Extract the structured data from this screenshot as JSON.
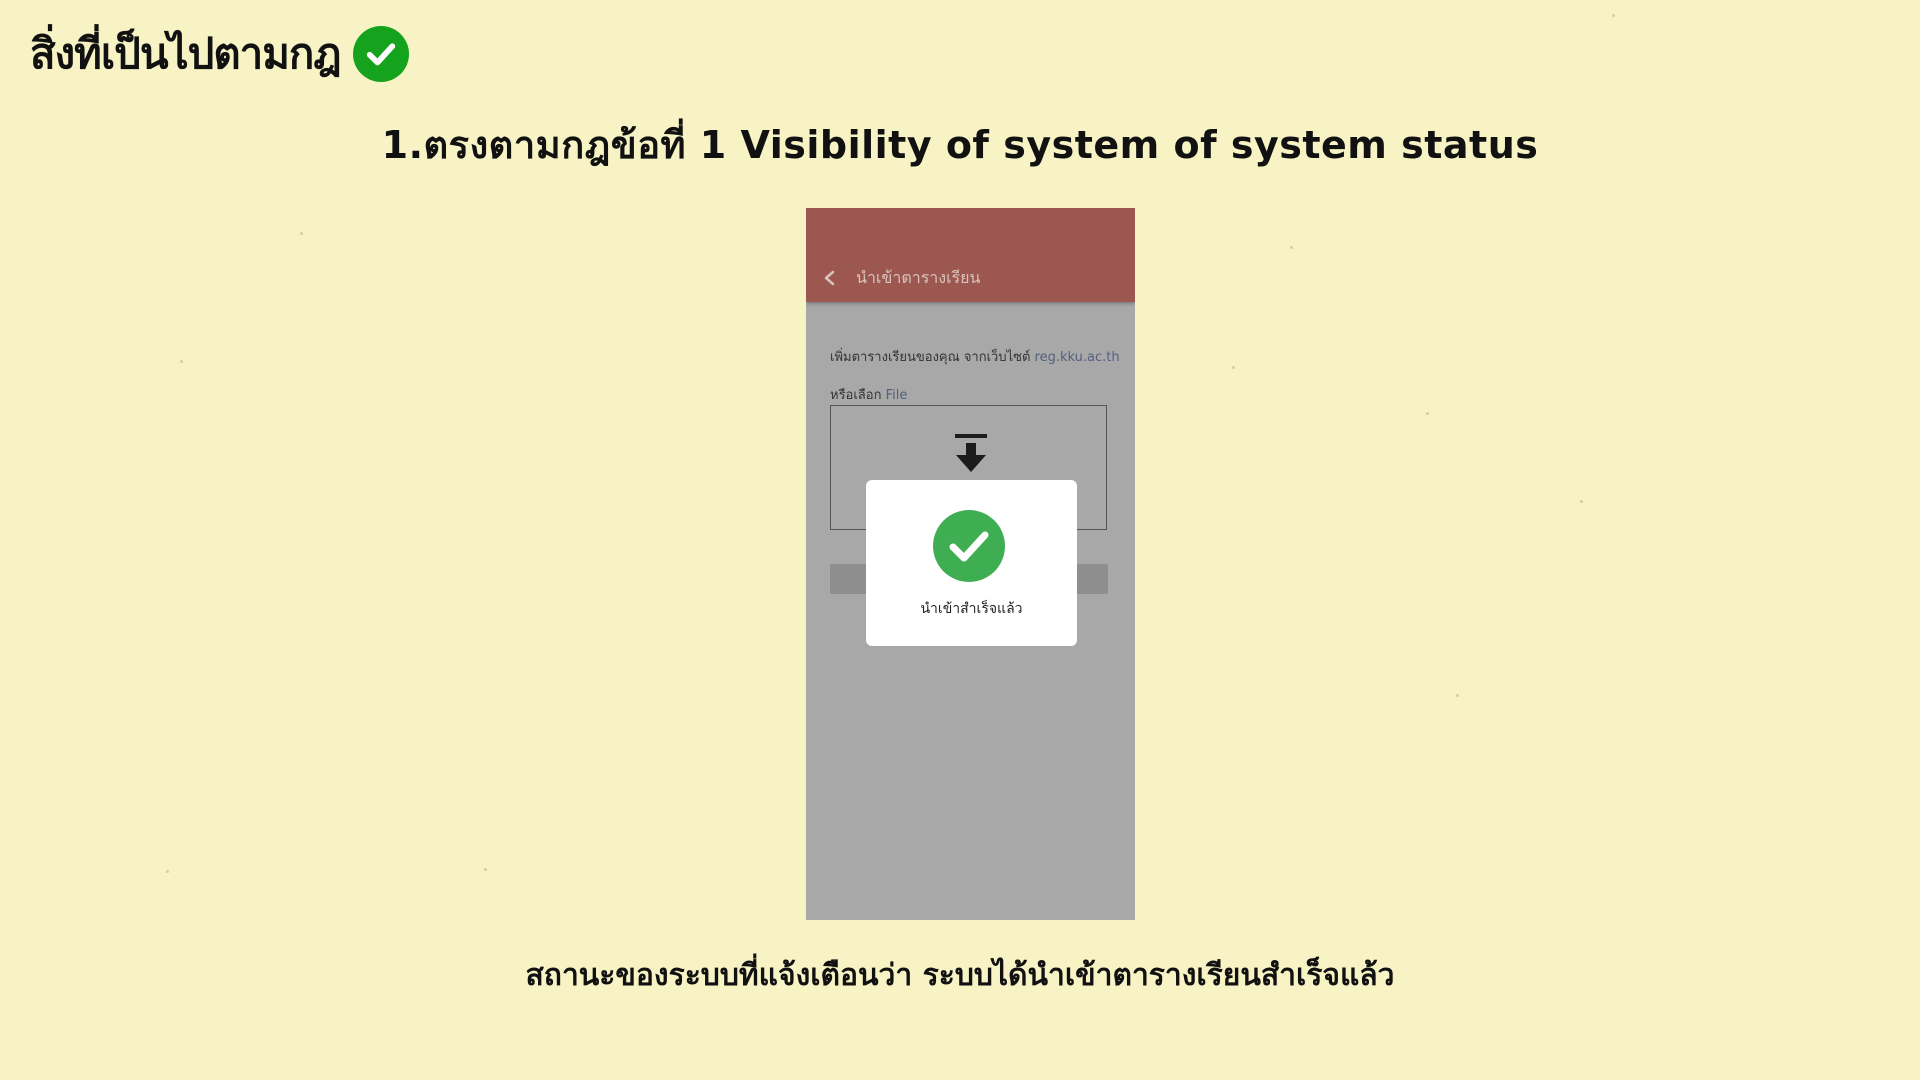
{
  "slide": {
    "corner_heading": "สิ่งที่เป็นไปตามกฎ",
    "title": "1.ตรงตามกฎข้อที่ 1 Visibility of system of system status",
    "caption": "สถานะของระบบที่แจ้งเตือนว่า ระบบได้นำเข้าตารางเรียนสำเร็จแล้ว",
    "background_color": "#f7f3c4",
    "accent_green": "#15a21d"
  },
  "phone": {
    "appbar": {
      "back_icon": "chevron-left-icon",
      "title": "นำเข้าตารางเรียน",
      "color": "#9c5850"
    },
    "instruction": {
      "text": "เพิ่มตารางเรียนของคุณ จากเว็บไซต์",
      "link": "reg.kku.ac.th"
    },
    "choose": {
      "text": "หรือเลือก",
      "link": "File"
    },
    "upload_icon": "download-arrow-icon",
    "dialog": {
      "icon": "check-circle-icon",
      "message": "นำเข้าสำเร็จแล้ว"
    }
  }
}
